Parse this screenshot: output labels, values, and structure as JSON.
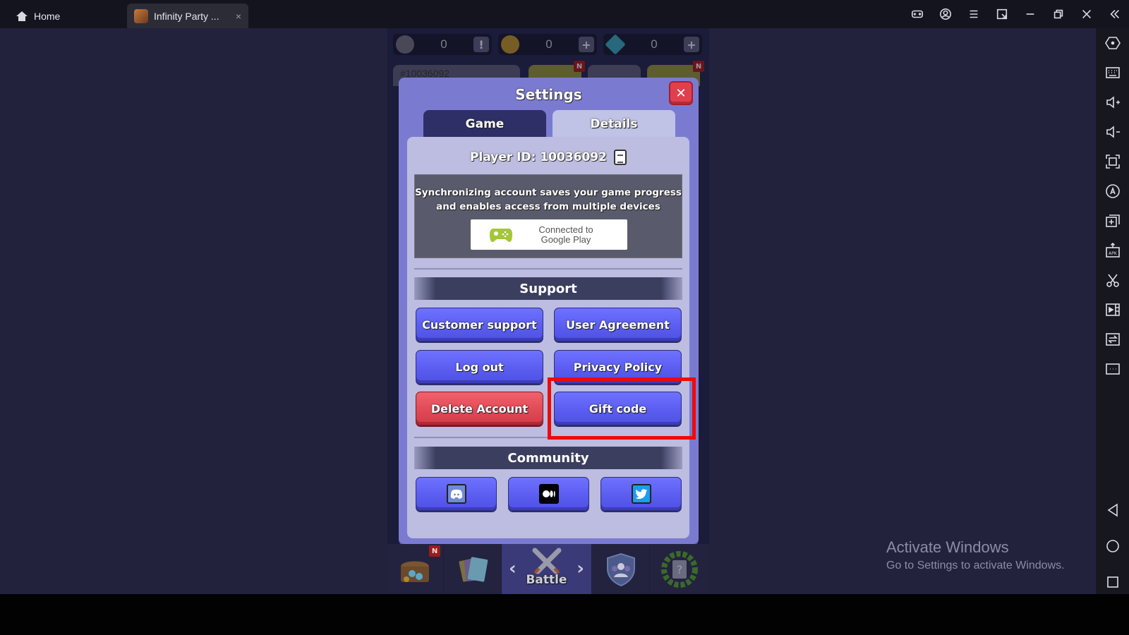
{
  "titlebar": {
    "home_tab": {
      "label": "Home",
      "icon": "home-icon"
    },
    "app_tab": {
      "label": "Infinity Party ...",
      "icon": "app-thumbnail",
      "close": "×"
    },
    "controls": [
      "gamepad-icon",
      "account-icon",
      "menu-icon",
      "window-resize-icon",
      "minimize-icon",
      "restore-icon",
      "close-icon",
      "collapse-sidebar-icon"
    ]
  },
  "sidebar": {
    "items": [
      "settings-hex-icon",
      "keyboard-icon",
      "volume-up-icon",
      "volume-down-icon",
      "fullscreen-icon",
      "auto-rotate-icon",
      "multi-instance-icon",
      "install-apk-icon",
      "screenshot-cut-icon",
      "record-video-icon",
      "sync-icon",
      "more-icon"
    ],
    "nav": [
      "back-icon",
      "home-circle-icon",
      "recents-square-icon"
    ]
  },
  "game": {
    "resources": [
      {
        "name": "rank",
        "value": "0",
        "button": "!"
      },
      {
        "name": "gold",
        "value": "0",
        "button": "+"
      },
      {
        "name": "gems",
        "value": "0",
        "button": "+"
      }
    ],
    "top_id_partial": "#10036092",
    "new_badge": "N"
  },
  "settings": {
    "title": "Settings",
    "close": "✕",
    "tabs": [
      {
        "label": "Game",
        "active": false
      },
      {
        "label": "Details",
        "active": true
      }
    ],
    "player_id_label": "Player ID: 10036092",
    "sync_text_line1": "Synchronizing account saves your game progress",
    "sync_text_line2": "and enables access from multiple devices",
    "google_play_line1": "Connected to",
    "google_play_line2": "Google Play",
    "support_heading": "Support",
    "support_buttons": [
      {
        "label": "Customer support",
        "style": "blue"
      },
      {
        "label": "User Agreement",
        "style": "blue"
      },
      {
        "label": "Log out",
        "style": "blue"
      },
      {
        "label": "Privacy Policy",
        "style": "blue"
      },
      {
        "label": "Delete Account",
        "style": "red"
      },
      {
        "label": "Gift code",
        "style": "blue",
        "highlighted": true
      }
    ],
    "community_heading": "Community",
    "community_buttons": [
      "discord-icon",
      "medium-icon",
      "twitter-icon"
    ]
  },
  "bottom_nav": {
    "items": [
      {
        "icon": "treasure-chest-icon",
        "badge": "N"
      },
      {
        "icon": "cards-icon"
      },
      {
        "icon": "crossed-swords-icon",
        "label": "Battle",
        "active": true
      },
      {
        "icon": "clan-shield-icon"
      },
      {
        "icon": "mystery-laurel-icon"
      }
    ]
  },
  "watermark": {
    "line1": "Activate Windows",
    "line2": "Go to Settings to activate Windows."
  },
  "colors": {
    "highlight": "#ee0a0a",
    "button_blue": "#5a5df0",
    "button_red": "#e04a56",
    "modal": "#7a7bd0"
  }
}
